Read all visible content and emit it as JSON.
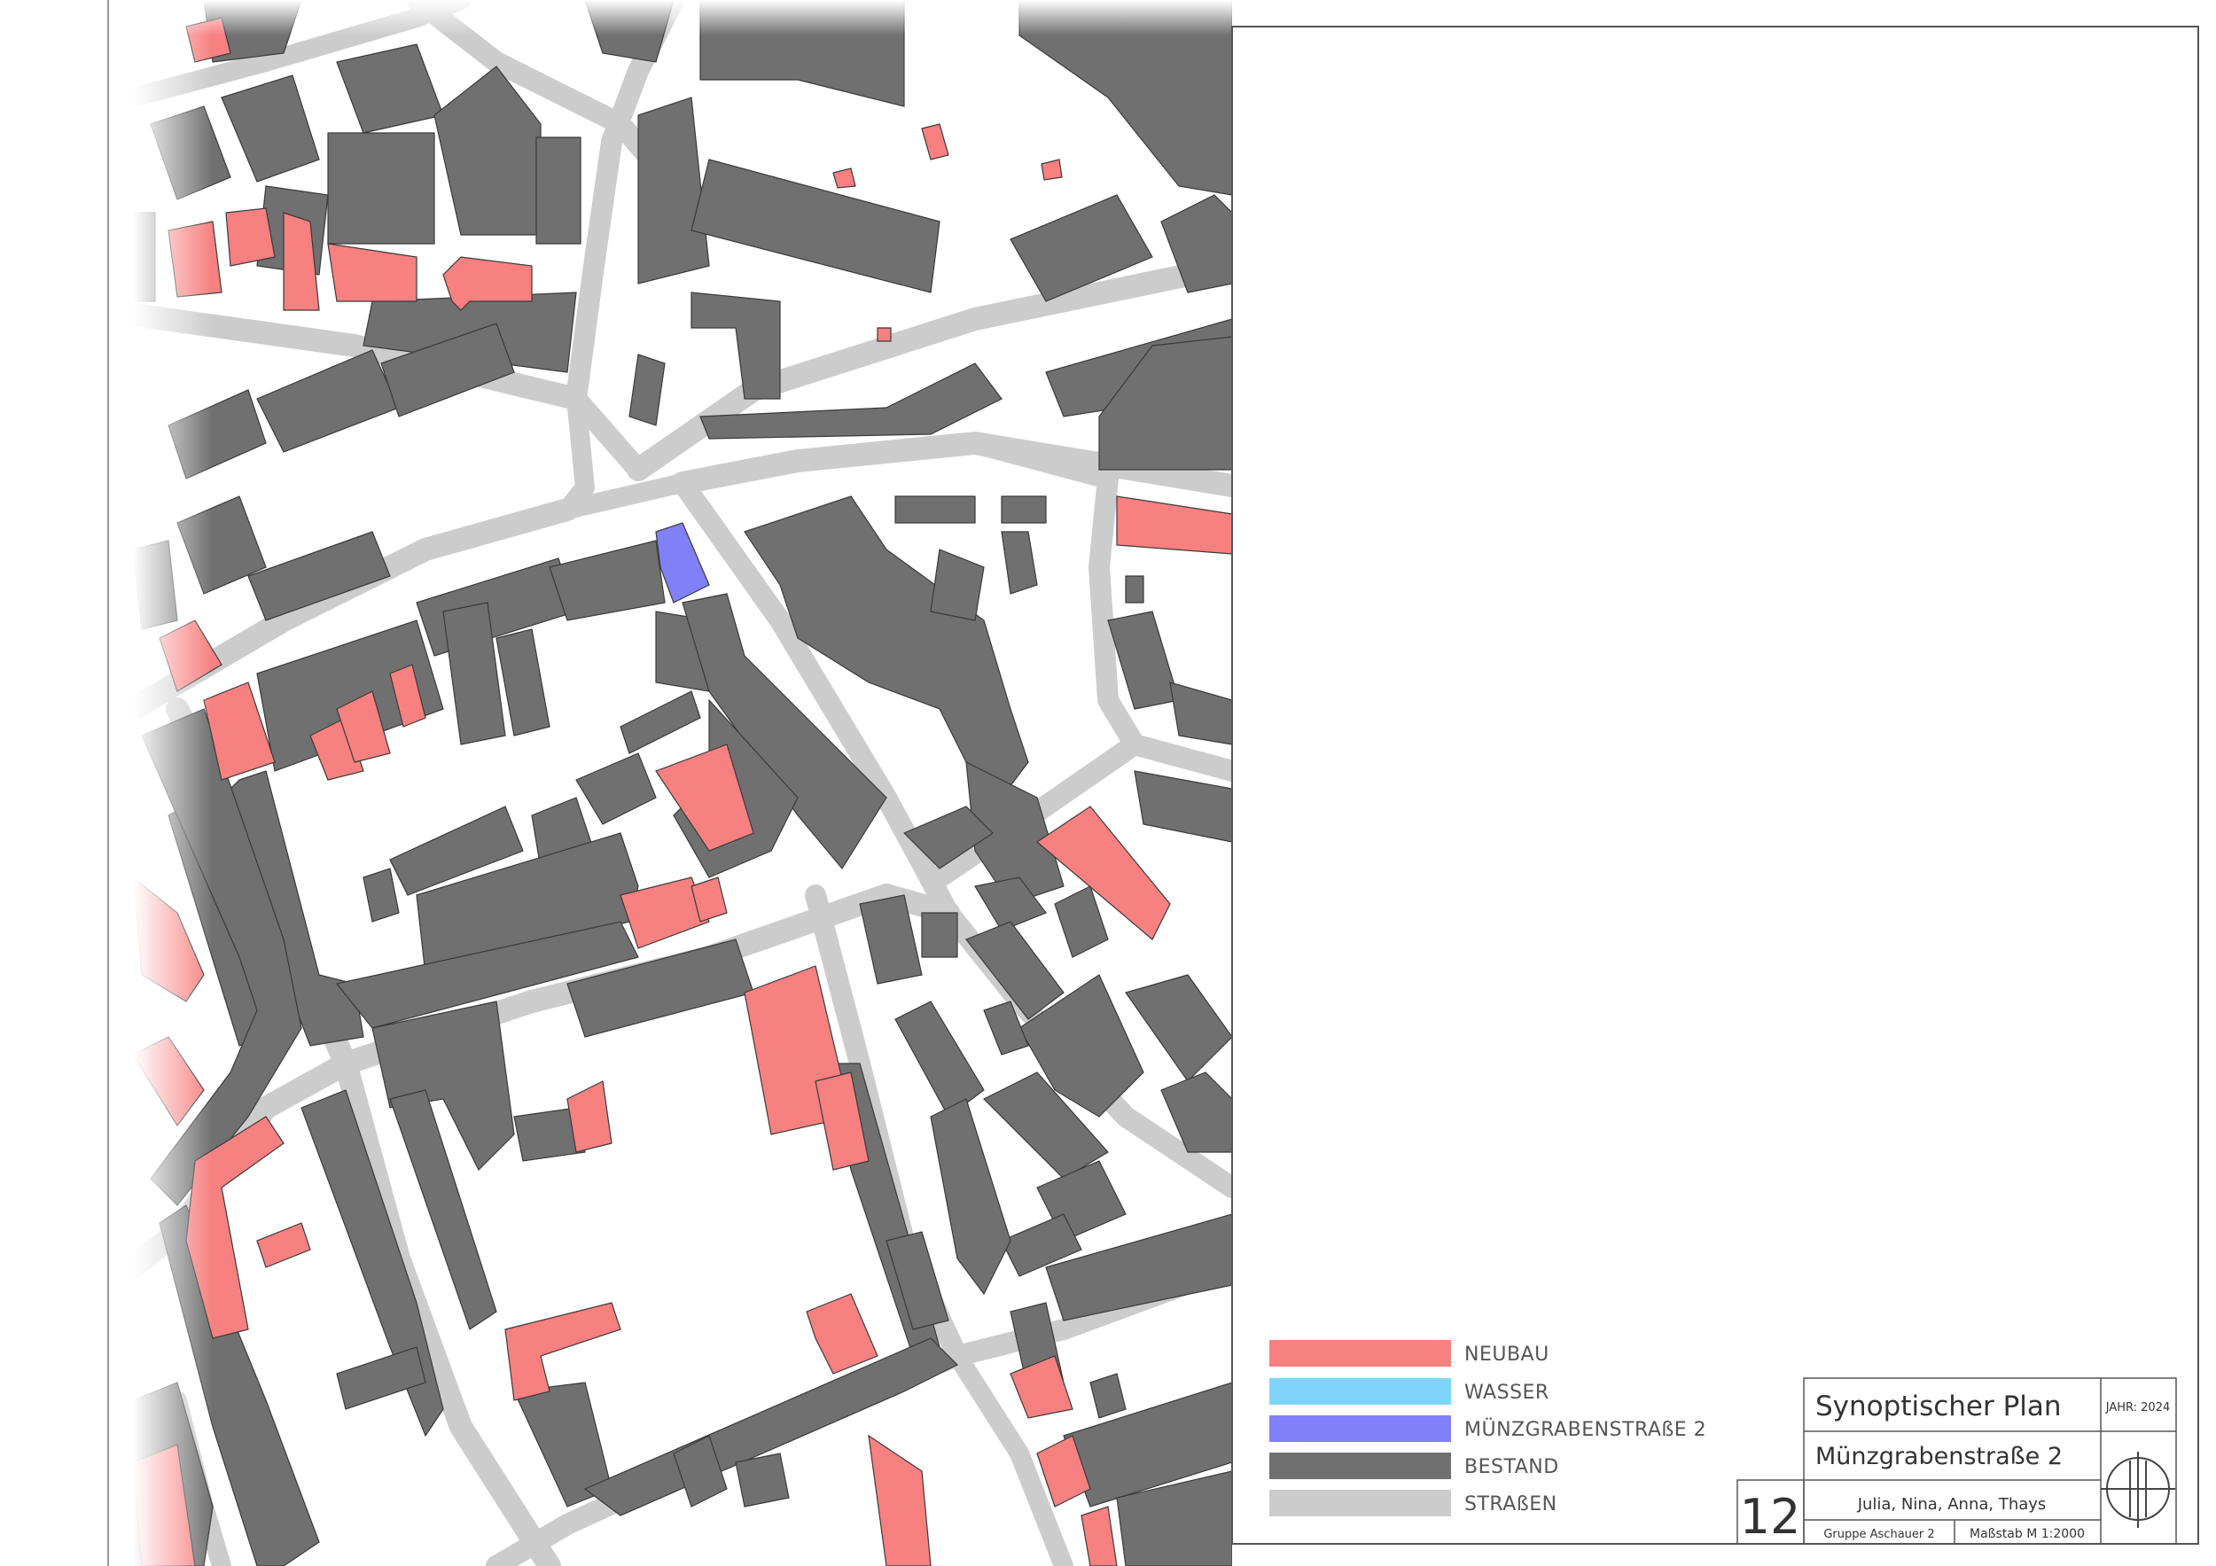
{
  "legend": {
    "items": [
      {
        "label": "NEUBAU",
        "color": "#f78080"
      },
      {
        "label": "WASSER",
        "color": "#80d4fa"
      },
      {
        "label": "MÜNZGRABENSTRAßE 2",
        "color": "#8080f8"
      },
      {
        "label": "BESTAND",
        "color": "#707070"
      },
      {
        "label": "STRAßEN",
        "color": "#cccccc"
      }
    ]
  },
  "title_block": {
    "title": "Synoptischer Plan",
    "subtitle": "Münzgrabenstraße 2",
    "year": "JAHR: 2024",
    "sheet_number": "12",
    "authors": "Julia, Nina, Anna, Thays",
    "group": "Gruppe Aschauer 2",
    "scale": "Maßstab M 1:2000",
    "north_icon": "north-arrow-icon"
  },
  "colors": {
    "neubau": "#f78080",
    "bestand": "#707070",
    "strassen": "#cccccc",
    "highlight": "#8080f8",
    "wasser": "#80d4fa"
  }
}
